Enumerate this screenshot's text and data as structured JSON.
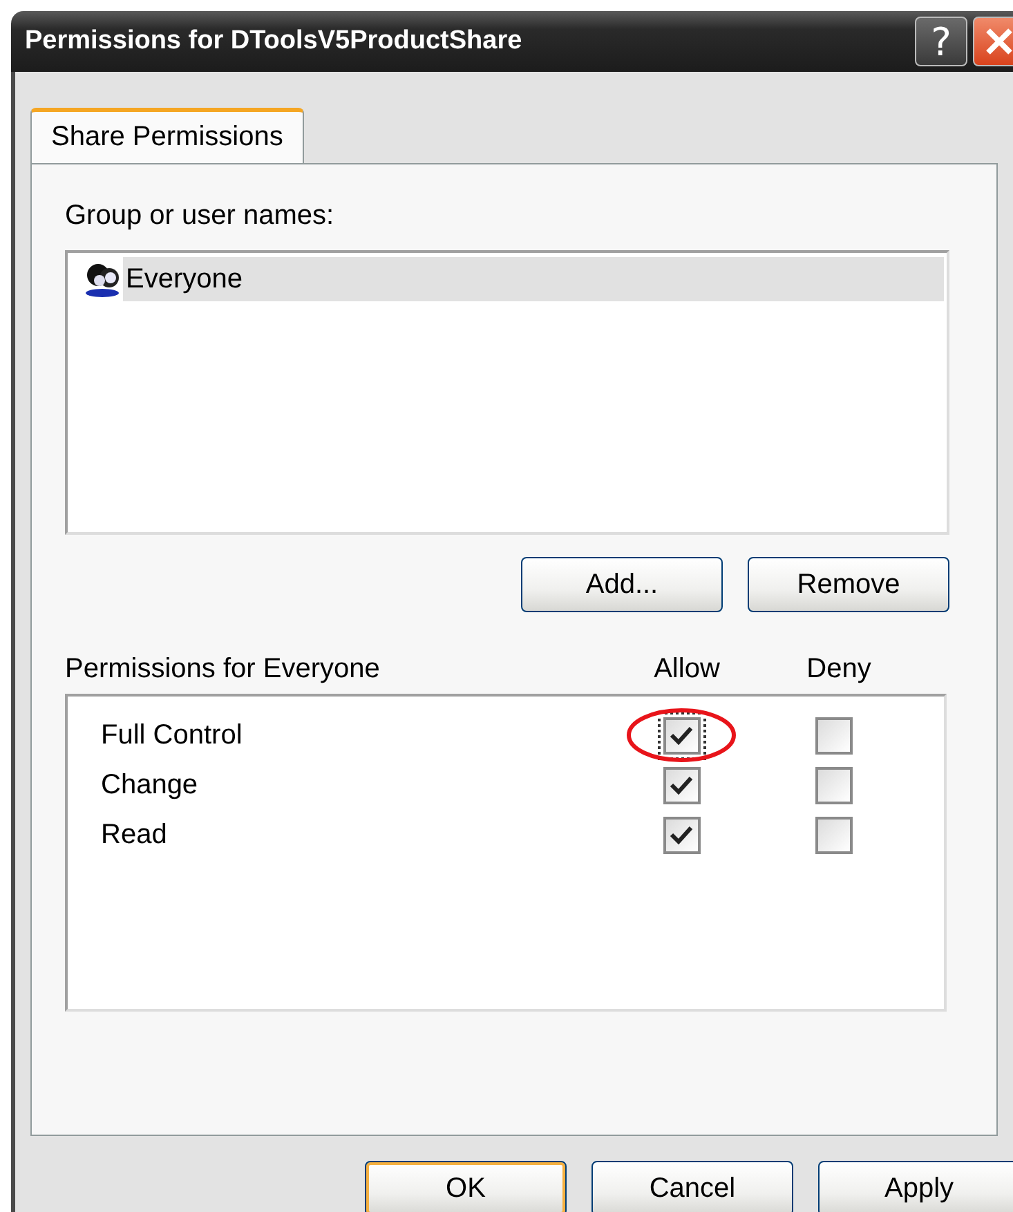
{
  "window": {
    "title": "Permissions for DToolsV5ProductShare",
    "title_buttons": [
      {
        "kind": "help",
        "label": "?"
      },
      {
        "kind": "close"
      }
    ]
  },
  "tabs": [
    {
      "label": "Share Permissions",
      "selected": true
    }
  ],
  "group_list": {
    "label": "Group or user names:",
    "items": [
      {
        "label": "Everyone",
        "selected": true
      }
    ]
  },
  "list_buttons": [
    {
      "label": "Add..."
    },
    {
      "label": "Remove"
    }
  ],
  "permissions": {
    "label": "Permissions for Everyone",
    "columns": [
      "Allow",
      "Deny"
    ],
    "rows": [
      {
        "name": "Full Control",
        "allow": {
          "checked": true,
          "focused": true,
          "circled": true
        },
        "deny": {
          "checked": false,
          "focused": false,
          "circled": false
        }
      },
      {
        "name": "Change",
        "allow": {
          "checked": true,
          "focused": false,
          "circled": false
        },
        "deny": {
          "checked": false,
          "focused": false,
          "circled": false
        }
      },
      {
        "name": "Read",
        "allow": {
          "checked": true,
          "focused": false,
          "circled": false
        },
        "deny": {
          "checked": false,
          "focused": false,
          "circled": false
        }
      }
    ]
  },
  "buttons": [
    {
      "label": "OK",
      "default": true
    },
    {
      "label": "Cancel",
      "default": false
    },
    {
      "label": "Apply",
      "default": false
    }
  ]
}
